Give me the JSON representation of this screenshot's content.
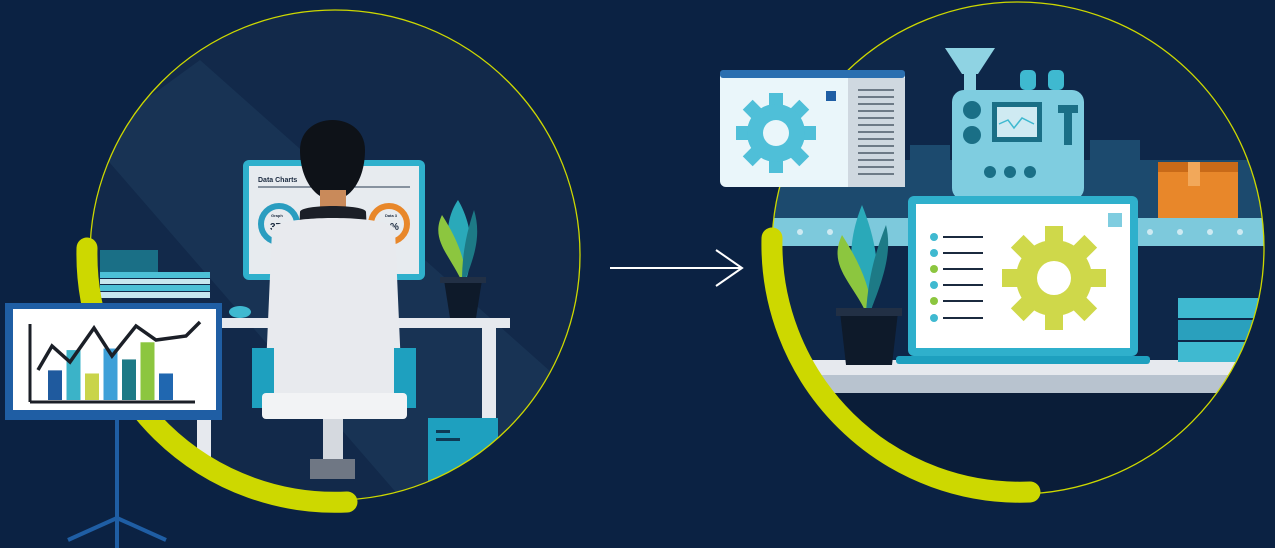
{
  "left_scene": {
    "monitor_title": "Data Charts",
    "gauge_left_label": "Graph",
    "gauge_left_value": "37",
    "gauge_right_label": "Data 3",
    "gauge_right_value": "%"
  },
  "easel_chart": {
    "bar_levels": [
      0.38,
      0.64,
      0.34,
      0.66,
      0.52,
      0.74,
      0.34
    ],
    "bar_colors": [
      "#1f5a9e",
      "#3bb3c8",
      "#c9d44a",
      "#3ea0d8",
      "#1d7a86",
      "#8cc63f",
      "#2067b0"
    ]
  },
  "colors": {
    "background": "#0b2243",
    "accent_lime": "#cdd800",
    "teal": "#3fb9d0",
    "orange": "#e8872a"
  },
  "icons": [
    "gear-icon",
    "arrow-right-icon",
    "bar-chart-icon"
  ]
}
